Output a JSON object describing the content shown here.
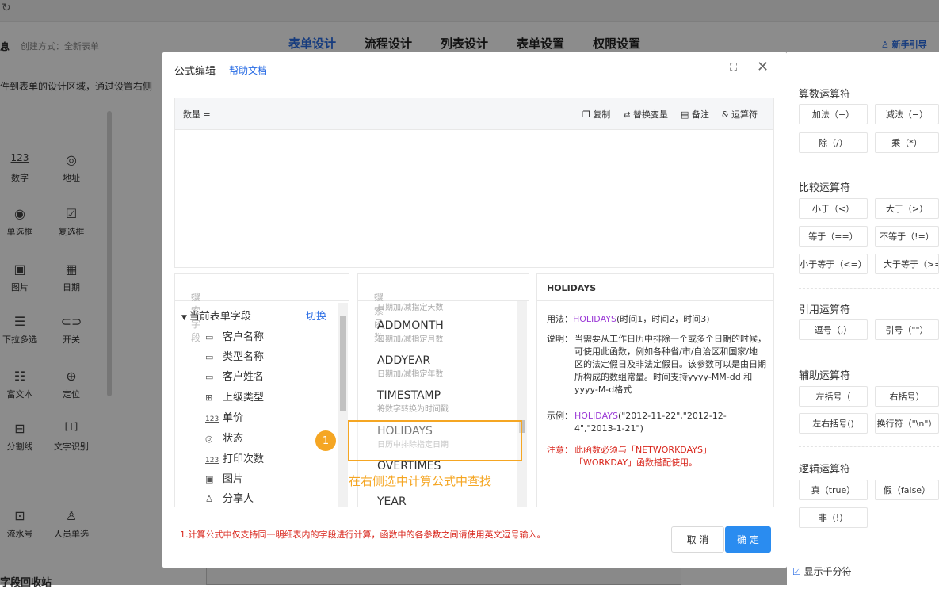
{
  "topbar": {
    "refresh_icon": "refresh-icon"
  },
  "header": {
    "info": "息",
    "create_mode": "创建方式：全新表单",
    "desc": "件到表单的设计区域，通过设置右侧",
    "tabs": [
      "表单设计",
      "流程设计",
      "列表设计",
      "表单设置",
      "权限设置"
    ],
    "guide": "新手引导"
  },
  "left_panel": {
    "items": [
      {
        "icon": "123",
        "label": "数字"
      },
      {
        "icon": "◎",
        "label": "地址"
      },
      {
        "icon": "◉",
        "label": "单选框"
      },
      {
        "icon": "☑",
        "label": "复选框"
      },
      {
        "icon": "▣",
        "label": "图片"
      },
      {
        "icon": "▦",
        "label": "日期"
      },
      {
        "icon": "☰",
        "label": "下拉多选"
      },
      {
        "icon": "⊂⊃",
        "label": "开关"
      },
      {
        "icon": "☷",
        "label": "富文本"
      },
      {
        "icon": "⊕",
        "label": "定位"
      },
      {
        "icon": "⊟",
        "label": "分割线"
      },
      {
        "icon": "[T]",
        "label": "文字识别"
      },
      {
        "icon": "⊡",
        "label": "流水号"
      },
      {
        "icon": "♙",
        "label": "人员单选"
      }
    ],
    "recycle": "字段回收站"
  },
  "dialog": {
    "title": "公式编辑",
    "help": "帮助文档",
    "editor_label": "数量 =",
    "tools": [
      "复制",
      "替换变量",
      "备注",
      "运算符"
    ],
    "field_search_placeholder": "搜索字段",
    "func_search_placeholder": "搜索函数",
    "field_group": "当前表单字段",
    "switch": "切换",
    "fields": [
      {
        "icon": "▭",
        "label": "客户名称"
      },
      {
        "icon": "▭",
        "label": "类型名称"
      },
      {
        "icon": "▭",
        "label": "客户姓名"
      },
      {
        "icon": "⊞",
        "label": "上级类型"
      },
      {
        "icon": "123",
        "label": "单价"
      },
      {
        "icon": "◎",
        "label": "状态"
      },
      {
        "icon": "123",
        "label": "打印次数"
      },
      {
        "icon": "▣",
        "label": "图片"
      },
      {
        "icon": "♙",
        "label": "分享人"
      }
    ],
    "functions": [
      {
        "name": "",
        "desc": "日期加/减指定天数"
      },
      {
        "name": "ADDMONTH",
        "desc": "日期加/减指定月数"
      },
      {
        "name": "ADDYEAR",
        "desc": "日期加/减指定年数"
      },
      {
        "name": "TIMESTAMP",
        "desc": "将数字转换为时间戳"
      },
      {
        "name": "HOLIDAYS",
        "desc": "日历中排除指定日期"
      },
      {
        "name": "OVERTIMES",
        "desc": ""
      },
      {
        "name": "YEAR",
        "desc": ""
      }
    ],
    "detail": {
      "title": "HOLIDAYS",
      "usage_label": "用法：",
      "usage_func": "HOLIDAYS",
      "usage_args": "(时间1，时间2，时间3)",
      "desc_label": "说明：",
      "desc_text": "当需要从工作日历中排除一个或多个日期的时候，可使用此函数，例如各种省/市/自治区和国家/地区的法定假日及非法定假日。该参数可以是由日期所构成的数组常量。时间支持yyyy-MM-dd 和 yyyy-M-d格式",
      "example_label": "示例：",
      "example_func": "HOLIDAYS",
      "example_args": "(\"2012-11-22\",\"2012-12-4\",\"2013-1-21\")",
      "note_label": "注意：",
      "note_text": "此函数必须与「NETWORKDAYS」「WORKDAY」函数搭配使用。"
    },
    "bottom_note": "1.计算公式中仅支持同一明细表内的字段进行计算，函数中的各参数之间请使用英文逗号输入。",
    "cancel": "取 消",
    "ok": "确 定"
  },
  "annotation": {
    "number": "1",
    "text": "在右侧选中计算公式中查找"
  },
  "operators": {
    "sections": [
      {
        "title": "算数运算符",
        "buttons": [
          "加法（+）",
          "减法（−）",
          "除（/）",
          "乘（*）"
        ]
      },
      {
        "title": "比较运算符",
        "buttons": [
          "小于（<）",
          "大于（>）",
          "等于（==）",
          "不等于（!=）",
          "小于等于（<=）",
          "大于等于（>="
        ]
      },
      {
        "title": "引用运算符",
        "buttons": [
          "逗号（,）",
          "引号（\"\"）"
        ]
      },
      {
        "title": "辅助运算符",
        "buttons": [
          "左括号（",
          "右括号）",
          "左右括号()",
          "换行符（\"\\n\"）"
        ]
      },
      {
        "title": "逻辑运算符",
        "buttons": [
          "真（true）",
          "假（false）",
          "非（!）"
        ]
      }
    ],
    "show_sep": "显示千分符"
  },
  "colors": {
    "accent": "#2a6de5",
    "highlight": "#f5a623",
    "purple": "#9b3ad6",
    "red": "#d9261c"
  }
}
